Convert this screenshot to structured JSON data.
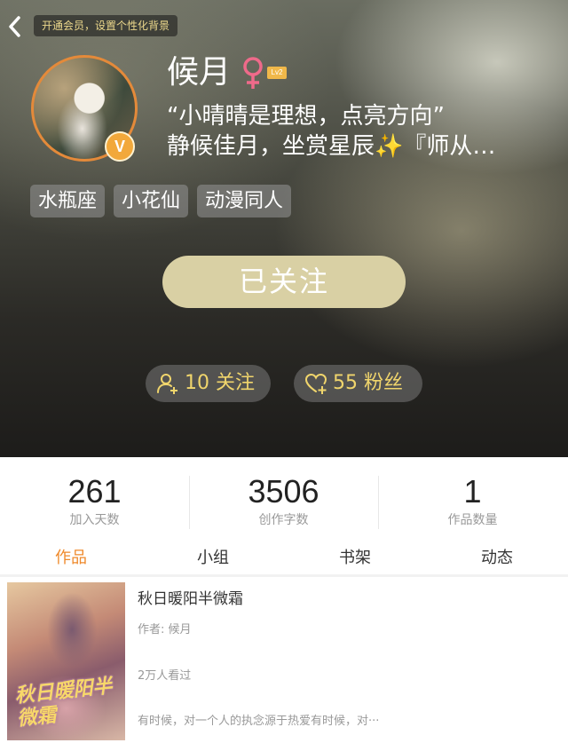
{
  "header": {
    "vip_tip": "开通会员，设置个性化背景"
  },
  "profile": {
    "name": "候月",
    "gender_icon": "female-icon",
    "level": "Lv2",
    "verified_badge": "V",
    "signature_line1": "“小晴晴是理想，点亮方向”",
    "signature_line2": "静候佳月，坐赏星辰✨『师从…",
    "tags": [
      "水瓶座",
      "小花仙",
      "动漫同人"
    ]
  },
  "actions": {
    "follow_label": "已关注",
    "following_label": "10 关注",
    "fans_label": "55 粉丝"
  },
  "stats": [
    {
      "value": "261",
      "label": "加入天数"
    },
    {
      "value": "3506",
      "label": "创作字数"
    },
    {
      "value": "1",
      "label": "作品数量"
    }
  ],
  "tabs": [
    "作品",
    "小组",
    "书架",
    "动态"
  ],
  "active_tab": "作品",
  "works": [
    {
      "title": "秋日暖阳半微霜",
      "author": "作者: 候月",
      "views": "2万人看过",
      "description": "有时候，对一个人的执念源于热爱有时候，对···",
      "cover_text": "秋日暖阳半微霜"
    }
  ],
  "colors": {
    "accent": "#ef8a2c",
    "follow_button": "#d9d0a4",
    "stat_pill_text": "#f0d56c",
    "vip_text": "#ecd88c"
  }
}
